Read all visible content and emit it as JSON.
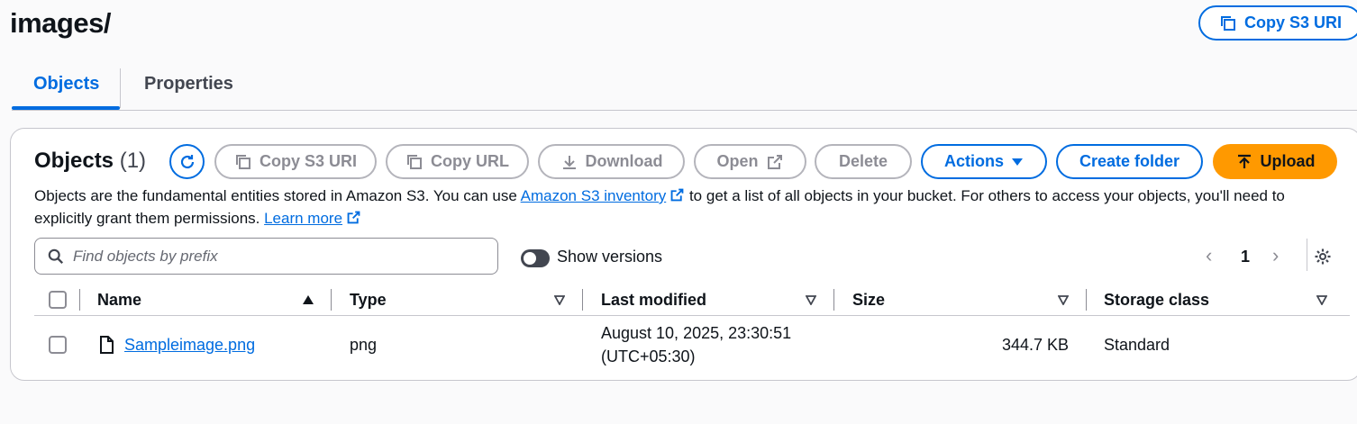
{
  "page": {
    "title": "images/",
    "copy_s3_uri_label": "Copy S3 URI"
  },
  "tabs": [
    {
      "label": "Objects",
      "active": true
    },
    {
      "label": "Properties",
      "active": false
    }
  ],
  "objects_panel": {
    "title": "Objects",
    "count": "(1)",
    "toolbar": {
      "copy_s3_uri": "Copy S3 URI",
      "copy_url": "Copy URL",
      "download": "Download",
      "open": "Open",
      "delete": "Delete",
      "actions": "Actions",
      "create_folder": "Create folder",
      "upload": "Upload"
    },
    "description": {
      "part1": "Objects are the fundamental entities stored in Amazon S3. You can use ",
      "link1": "Amazon S3 inventory",
      "part2": " to get a list of all objects in your bucket. For others to access your objects, you'll need to explicitly grant them permissions. ",
      "link2": "Learn more"
    },
    "search": {
      "placeholder": "Find objects by prefix",
      "value": ""
    },
    "show_versions": {
      "label": "Show versions",
      "enabled": false
    },
    "pagination": {
      "current_page": "1"
    },
    "table": {
      "columns": [
        "Name",
        "Type",
        "Last modified",
        "Size",
        "Storage class"
      ],
      "rows": [
        {
          "name": "Sampleimage.png",
          "type": "png",
          "last_modified_line1": "August 10, 2025, 23:30:51",
          "last_modified_line2": "(UTC+05:30)",
          "size": "344.7 KB",
          "storage_class": "Standard"
        }
      ]
    }
  },
  "colors": {
    "accent": "#006ce0",
    "upload": "#ff9900",
    "text": "#0f141a",
    "disabled": "#8c8c94"
  }
}
